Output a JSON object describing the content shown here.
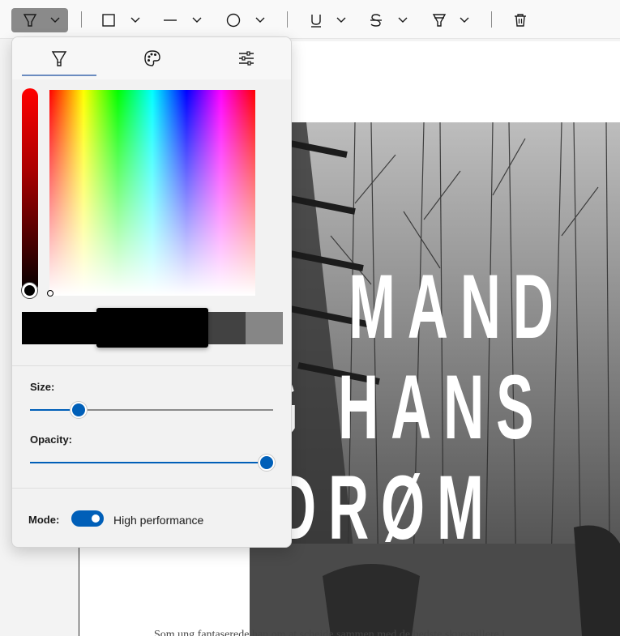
{
  "toolbar": {
    "tools": [
      {
        "name": "highlighter-icon",
        "active": true
      },
      {
        "name": "rectangle-icon"
      },
      {
        "name": "line-icon"
      },
      {
        "name": "ellipse-icon"
      },
      {
        "name": "underline-icon"
      },
      {
        "name": "strikethrough-icon"
      },
      {
        "name": "marker-icon"
      },
      {
        "name": "delete-icon"
      }
    ]
  },
  "panel": {
    "tabs": [
      "highlighter-icon",
      "palette-icon",
      "sliders-icon"
    ],
    "active_tab": 0,
    "swatches": [
      "#000000",
      "#000000",
      "#424242",
      "#868686"
    ],
    "size_label": "Size:",
    "size_value": 0.2,
    "opacity_label": "Opacity:",
    "opacity_value": 1.0,
    "mode_label": "Mode:",
    "mode_value": "High performance",
    "mode_on": true
  },
  "document": {
    "photo_lines": [
      "MAND",
      "G HANS",
      "DRØM"
    ],
    "caption": "Som ung fantaserede han om at scheide sammen med de bedste skuespillere i"
  },
  "colors": {
    "accent": "#005fb8",
    "selected_color": "#000000"
  }
}
